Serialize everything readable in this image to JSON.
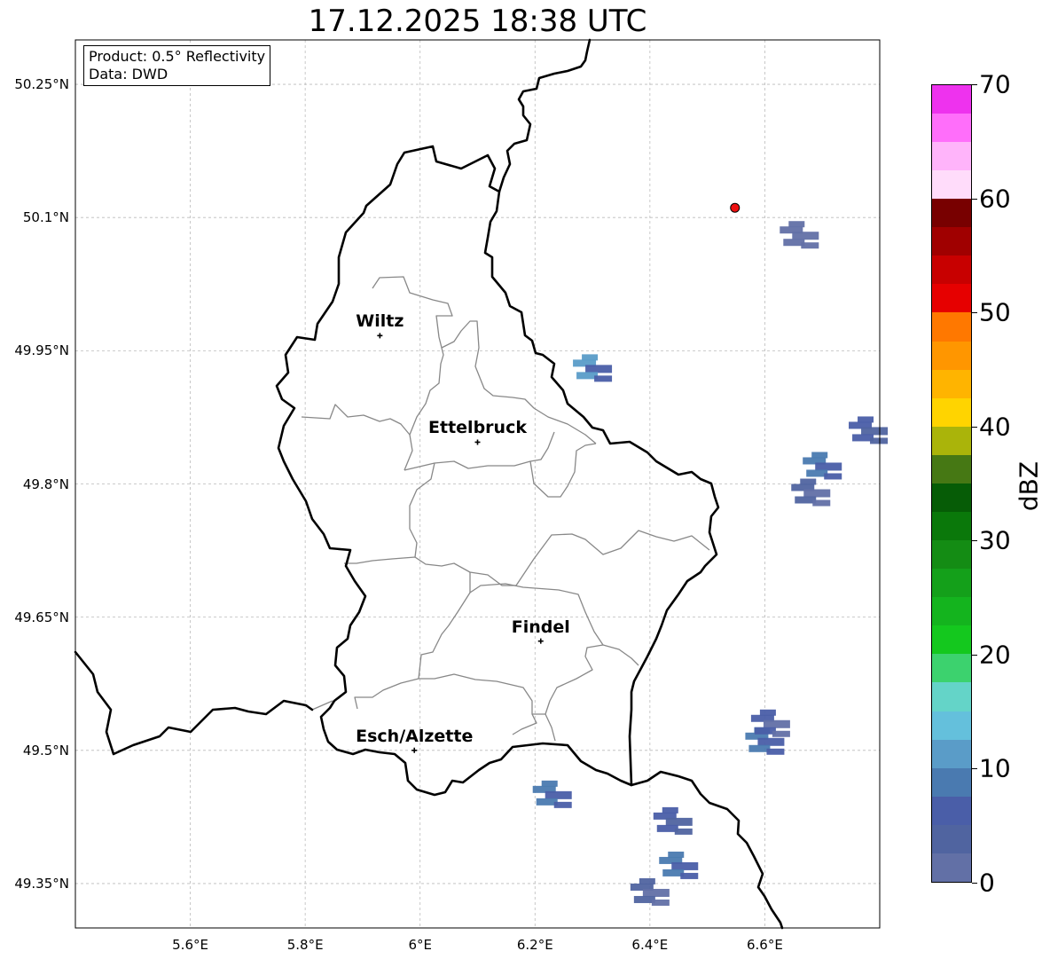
{
  "title": "17.12.2025 18:38 UTC",
  "info": {
    "product": "Product: 0.5° Reflectivity",
    "data": "Data: DWD"
  },
  "map": {
    "extent": {
      "lon_min": 5.4,
      "lon_max": 6.8,
      "lat_min": 49.3,
      "lat_max": 50.3
    },
    "lat_ticks": [
      {
        "value": 50.25,
        "label": "50.25°N"
      },
      {
        "value": 50.1,
        "label": "50.1°N"
      },
      {
        "value": 49.95,
        "label": "49.95°N"
      },
      {
        "value": 49.8,
        "label": "49.8°N"
      },
      {
        "value": 49.65,
        "label": "49.65°N"
      },
      {
        "value": 49.5,
        "label": "49.5°N"
      },
      {
        "value": 49.35,
        "label": "49.35°N"
      }
    ],
    "lon_ticks": [
      {
        "value": 5.6,
        "label": "5.6°E"
      },
      {
        "value": 5.8,
        "label": "5.8°E"
      },
      {
        "value": 6.0,
        "label": "6°E"
      },
      {
        "value": 6.2,
        "label": "6.2°E"
      },
      {
        "value": 6.4,
        "label": "6.4°E"
      },
      {
        "value": 6.6,
        "label": "6.6°E"
      }
    ],
    "cities": [
      {
        "name": "Wiltz",
        "lon": 5.93,
        "lat": 49.967
      },
      {
        "name": "Ettelbruck",
        "lon": 6.1,
        "lat": 49.847
      },
      {
        "name": "Findel",
        "lon": 6.21,
        "lat": 49.623
      },
      {
        "name": "Esch/Alzette",
        "lon": 5.99,
        "lat": 49.5
      }
    ],
    "radar_site": {
      "lon": 6.548,
      "lat": 50.111,
      "color": "#ee1111"
    },
    "echoes": [
      {
        "lon": 6.23,
        "lat": 49.45,
        "dbz": 8
      },
      {
        "lon": 6.44,
        "lat": 49.42,
        "dbz": 6
      },
      {
        "lon": 6.45,
        "lat": 49.37,
        "dbz": 8
      },
      {
        "lon": 6.4,
        "lat": 49.34,
        "dbz": 3
      },
      {
        "lon": 6.6,
        "lat": 49.51,
        "dbz": 9
      },
      {
        "lon": 6.61,
        "lat": 49.53,
        "dbz": 5
      },
      {
        "lon": 6.7,
        "lat": 49.82,
        "dbz": 9
      },
      {
        "lon": 6.68,
        "lat": 49.79,
        "dbz": 4
      },
      {
        "lon": 6.78,
        "lat": 49.86,
        "dbz": 7
      },
      {
        "lon": 6.66,
        "lat": 50.08,
        "dbz": 2
      },
      {
        "lon": 6.3,
        "lat": 49.93,
        "dbz": 10
      }
    ]
  },
  "colorbar": {
    "label": "dBZ",
    "ticks": [
      0,
      10,
      20,
      30,
      40,
      50,
      60,
      70
    ],
    "colors": [
      "#6270a6",
      "#5064a0",
      "#4a5ea8",
      "#4a7ab0",
      "#5a9cc8",
      "#64c0dc",
      "#64d4c8",
      "#3cd26e",
      "#14c81e",
      "#14b41e",
      "#14a01a",
      "#148c14",
      "#0a780a",
      "#065c06",
      "#467814",
      "#aab40a",
      "#ffd400",
      "#ffb400",
      "#ff9600",
      "#ff7800",
      "#e60000",
      "#c80000",
      "#a00000",
      "#780000",
      "#ffdcfa",
      "#ffb4fa",
      "#ff6efa",
      "#ee32ee"
    ]
  }
}
